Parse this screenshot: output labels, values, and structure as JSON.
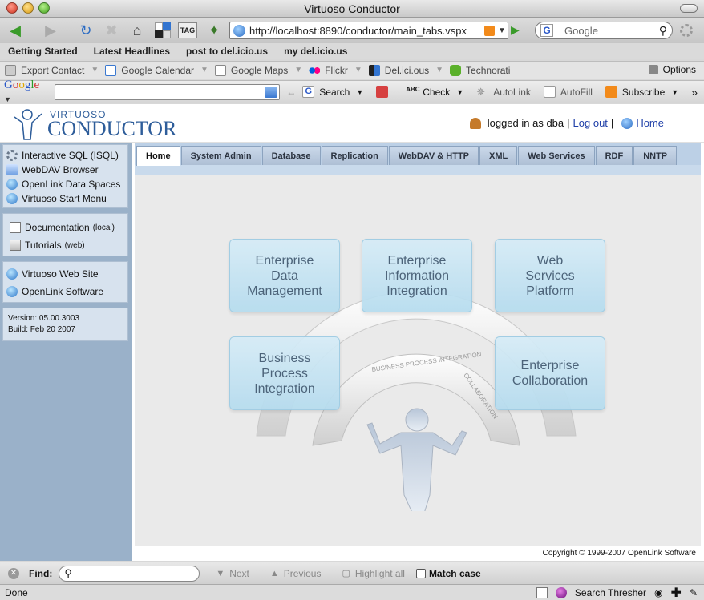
{
  "window": {
    "title": "Virtuoso Conductor"
  },
  "nav": {
    "url": "http://localhost:8890/conductor/main_tabs.vspx",
    "search_placeholder": "Google"
  },
  "bookmarks": [
    "Getting Started",
    "Latest Headlines",
    "post to del.icio.us",
    "my del.icio.us"
  ],
  "extensions": {
    "items": [
      "Export Contact",
      "Google Calendar",
      "Google Maps",
      "Flickr",
      "Del.ici.ous",
      "Technorati"
    ],
    "options": "Options"
  },
  "google_toolbar": {
    "logo": "Google",
    "search": "Search",
    "check": "Check",
    "autolink": "AutoLink",
    "autofill": "AutoFill",
    "subscribe": "Subscribe"
  },
  "header": {
    "logo_top": "VIRTUOSO",
    "logo_main": "CONDUCTOR",
    "logged_in": "logged in as dba",
    "logout": "Log out",
    "separator": "|",
    "home": "Home"
  },
  "sidebar": {
    "group1": [
      "Interactive SQL (ISQL)",
      "WebDAV Browser",
      "OpenLink Data Spaces",
      "Virtuoso Start Menu"
    ],
    "group2": [
      {
        "label": "Documentation",
        "note": "(local)"
      },
      {
        "label": "Tutorials",
        "note": "(web)"
      }
    ],
    "group3": [
      "Virtuoso Web Site",
      "OpenLink Software"
    ],
    "version": "Version: 05.00.3003",
    "build": "Build: Feb 20 2007"
  },
  "tabs": [
    "Home",
    "System Admin",
    "Database",
    "Replication",
    "WebDAV & HTTP",
    "XML",
    "Web Services",
    "RDF",
    "NNTP"
  ],
  "diagram": {
    "boxes": [
      "Enterprise\nData\nManagement",
      "Enterprise\nInformation\nIntegration",
      "Web\nServices\nPlatform",
      "Business\nProcess\nIntegration",
      "Enterprise\nCollaboration"
    ],
    "arc_labels": [
      "BUSINESS PROCESS INTEGRATION",
      "COLLABORATION"
    ]
  },
  "footer": "Copyright © 1999-2007 OpenLink Software",
  "findbar": {
    "label": "Find:",
    "next": "Next",
    "previous": "Previous",
    "highlight": "Highlight all",
    "match_case": "Match case"
  },
  "status": {
    "text": "Done",
    "thresher": "Search Thresher"
  },
  "colors": {
    "sidebar": "#9ab1c9",
    "tabs": "#bcd0e6",
    "link": "#1f3fa8",
    "box": "#b5dcef"
  }
}
